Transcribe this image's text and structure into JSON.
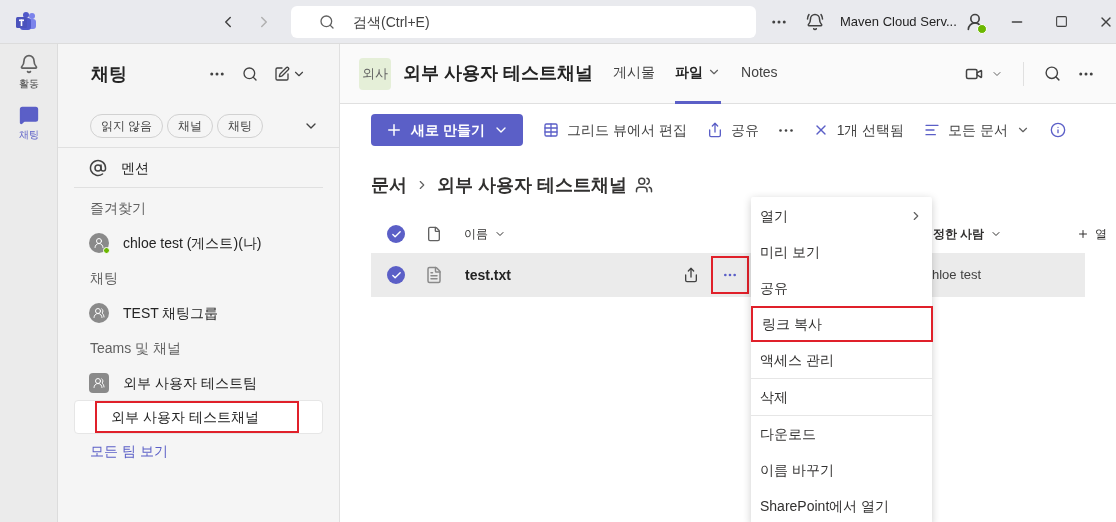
{
  "titlebar": {
    "search_placeholder": "검색(Ctrl+E)",
    "account": "Maven Cloud Serv..."
  },
  "rail": [
    {
      "label": "활동",
      "kind": "bell",
      "selected": false
    },
    {
      "label": "채팅",
      "kind": "chat",
      "selected": true
    }
  ],
  "sidebar": {
    "title": "채팅",
    "filters": [
      "읽지 않음",
      "채널",
      "채팅"
    ],
    "items": [
      {
        "kind": "mention",
        "label": "멘션",
        "selected": false
      },
      {
        "kind": "heading",
        "label": "즐겨찾기"
      },
      {
        "kind": "person",
        "label": "chloe test (게스트)(나)",
        "selected": false
      },
      {
        "kind": "heading",
        "label": "채팅"
      },
      {
        "kind": "group",
        "label": "TEST 채팅그룹",
        "selected": false
      },
      {
        "kind": "heading",
        "label": "Teams 및 채널"
      },
      {
        "kind": "team",
        "label": "외부 사용자 테스트팀",
        "selected": false
      },
      {
        "kind": "channel",
        "label": "외부 사용자 테스트채널",
        "selected": true,
        "highlighted": true
      },
      {
        "kind": "link",
        "label": "모든 팀 보기"
      }
    ]
  },
  "channel": {
    "avatar": "외사",
    "title": "외부 사용자 테스트채널",
    "tabs": [
      {
        "label": "게시물",
        "selected": false,
        "dropdown": false
      },
      {
        "label": "파일",
        "selected": true,
        "dropdown": true
      },
      {
        "label": "Notes",
        "selected": false,
        "dropdown": false
      }
    ]
  },
  "toolbar": {
    "new_button": "새로 만들기",
    "actions": [
      {
        "kind": "grid",
        "label": "그리드 뷰에서 편집"
      },
      {
        "kind": "share",
        "label": "공유"
      },
      {
        "kind": "more"
      },
      {
        "kind": "clear",
        "label": "1개 선택됨"
      },
      {
        "kind": "view",
        "label": "모든 문서"
      },
      {
        "kind": "info"
      }
    ]
  },
  "breadcrumb": [
    "문서",
    "외부 사용자 테스트채널"
  ],
  "table": {
    "all_selected": true,
    "columns": [
      "이름",
      "정한 사람",
      "열"
    ],
    "rows": [
      {
        "name": "test.txt",
        "modified_by": "hloe test",
        "selected": true,
        "more_highlighted": true
      }
    ]
  },
  "context_menu": [
    {
      "label": "열기",
      "submenu": true,
      "highlighted": false
    },
    {
      "label": "미리 보기",
      "submenu": false,
      "highlighted": false
    },
    {
      "label": "공유",
      "submenu": false,
      "highlighted": false
    },
    {
      "label": "링크 복사",
      "submenu": false,
      "highlighted": true
    },
    {
      "label": "액세스 관리",
      "submenu": false,
      "highlighted": false,
      "divider_after": true
    },
    {
      "label": "삭제",
      "submenu": false,
      "highlighted": false,
      "divider_after": true
    },
    {
      "label": "다운로드",
      "submenu": false,
      "highlighted": false
    },
    {
      "label": "이름 바꾸기",
      "submenu": false,
      "highlighted": false
    },
    {
      "label": "SharePoint에서 열기",
      "submenu": false,
      "highlighted": false
    }
  ]
}
